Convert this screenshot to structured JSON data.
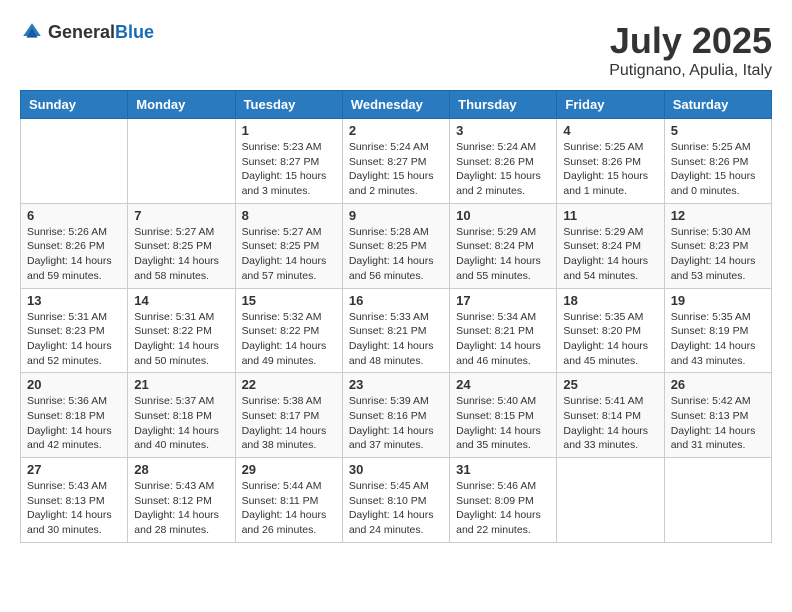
{
  "logo": {
    "text_general": "General",
    "text_blue": "Blue"
  },
  "title": {
    "month_year": "July 2025",
    "location": "Putignano, Apulia, Italy"
  },
  "headers": [
    "Sunday",
    "Monday",
    "Tuesday",
    "Wednesday",
    "Thursday",
    "Friday",
    "Saturday"
  ],
  "weeks": [
    [
      {
        "day": "",
        "sunrise": "",
        "sunset": "",
        "daylight": ""
      },
      {
        "day": "",
        "sunrise": "",
        "sunset": "",
        "daylight": ""
      },
      {
        "day": "1",
        "sunrise": "Sunrise: 5:23 AM",
        "sunset": "Sunset: 8:27 PM",
        "daylight": "Daylight: 15 hours and 3 minutes."
      },
      {
        "day": "2",
        "sunrise": "Sunrise: 5:24 AM",
        "sunset": "Sunset: 8:27 PM",
        "daylight": "Daylight: 15 hours and 2 minutes."
      },
      {
        "day": "3",
        "sunrise": "Sunrise: 5:24 AM",
        "sunset": "Sunset: 8:26 PM",
        "daylight": "Daylight: 15 hours and 2 minutes."
      },
      {
        "day": "4",
        "sunrise": "Sunrise: 5:25 AM",
        "sunset": "Sunset: 8:26 PM",
        "daylight": "Daylight: 15 hours and 1 minute."
      },
      {
        "day": "5",
        "sunrise": "Sunrise: 5:25 AM",
        "sunset": "Sunset: 8:26 PM",
        "daylight": "Daylight: 15 hours and 0 minutes."
      }
    ],
    [
      {
        "day": "6",
        "sunrise": "Sunrise: 5:26 AM",
        "sunset": "Sunset: 8:26 PM",
        "daylight": "Daylight: 14 hours and 59 minutes."
      },
      {
        "day": "7",
        "sunrise": "Sunrise: 5:27 AM",
        "sunset": "Sunset: 8:25 PM",
        "daylight": "Daylight: 14 hours and 58 minutes."
      },
      {
        "day": "8",
        "sunrise": "Sunrise: 5:27 AM",
        "sunset": "Sunset: 8:25 PM",
        "daylight": "Daylight: 14 hours and 57 minutes."
      },
      {
        "day": "9",
        "sunrise": "Sunrise: 5:28 AM",
        "sunset": "Sunset: 8:25 PM",
        "daylight": "Daylight: 14 hours and 56 minutes."
      },
      {
        "day": "10",
        "sunrise": "Sunrise: 5:29 AM",
        "sunset": "Sunset: 8:24 PM",
        "daylight": "Daylight: 14 hours and 55 minutes."
      },
      {
        "day": "11",
        "sunrise": "Sunrise: 5:29 AM",
        "sunset": "Sunset: 8:24 PM",
        "daylight": "Daylight: 14 hours and 54 minutes."
      },
      {
        "day": "12",
        "sunrise": "Sunrise: 5:30 AM",
        "sunset": "Sunset: 8:23 PM",
        "daylight": "Daylight: 14 hours and 53 minutes."
      }
    ],
    [
      {
        "day": "13",
        "sunrise": "Sunrise: 5:31 AM",
        "sunset": "Sunset: 8:23 PM",
        "daylight": "Daylight: 14 hours and 52 minutes."
      },
      {
        "day": "14",
        "sunrise": "Sunrise: 5:31 AM",
        "sunset": "Sunset: 8:22 PM",
        "daylight": "Daylight: 14 hours and 50 minutes."
      },
      {
        "day": "15",
        "sunrise": "Sunrise: 5:32 AM",
        "sunset": "Sunset: 8:22 PM",
        "daylight": "Daylight: 14 hours and 49 minutes."
      },
      {
        "day": "16",
        "sunrise": "Sunrise: 5:33 AM",
        "sunset": "Sunset: 8:21 PM",
        "daylight": "Daylight: 14 hours and 48 minutes."
      },
      {
        "day": "17",
        "sunrise": "Sunrise: 5:34 AM",
        "sunset": "Sunset: 8:21 PM",
        "daylight": "Daylight: 14 hours and 46 minutes."
      },
      {
        "day": "18",
        "sunrise": "Sunrise: 5:35 AM",
        "sunset": "Sunset: 8:20 PM",
        "daylight": "Daylight: 14 hours and 45 minutes."
      },
      {
        "day": "19",
        "sunrise": "Sunrise: 5:35 AM",
        "sunset": "Sunset: 8:19 PM",
        "daylight": "Daylight: 14 hours and 43 minutes."
      }
    ],
    [
      {
        "day": "20",
        "sunrise": "Sunrise: 5:36 AM",
        "sunset": "Sunset: 8:18 PM",
        "daylight": "Daylight: 14 hours and 42 minutes."
      },
      {
        "day": "21",
        "sunrise": "Sunrise: 5:37 AM",
        "sunset": "Sunset: 8:18 PM",
        "daylight": "Daylight: 14 hours and 40 minutes."
      },
      {
        "day": "22",
        "sunrise": "Sunrise: 5:38 AM",
        "sunset": "Sunset: 8:17 PM",
        "daylight": "Daylight: 14 hours and 38 minutes."
      },
      {
        "day": "23",
        "sunrise": "Sunrise: 5:39 AM",
        "sunset": "Sunset: 8:16 PM",
        "daylight": "Daylight: 14 hours and 37 minutes."
      },
      {
        "day": "24",
        "sunrise": "Sunrise: 5:40 AM",
        "sunset": "Sunset: 8:15 PM",
        "daylight": "Daylight: 14 hours and 35 minutes."
      },
      {
        "day": "25",
        "sunrise": "Sunrise: 5:41 AM",
        "sunset": "Sunset: 8:14 PM",
        "daylight": "Daylight: 14 hours and 33 minutes."
      },
      {
        "day": "26",
        "sunrise": "Sunrise: 5:42 AM",
        "sunset": "Sunset: 8:13 PM",
        "daylight": "Daylight: 14 hours and 31 minutes."
      }
    ],
    [
      {
        "day": "27",
        "sunrise": "Sunrise: 5:43 AM",
        "sunset": "Sunset: 8:13 PM",
        "daylight": "Daylight: 14 hours and 30 minutes."
      },
      {
        "day": "28",
        "sunrise": "Sunrise: 5:43 AM",
        "sunset": "Sunset: 8:12 PM",
        "daylight": "Daylight: 14 hours and 28 minutes."
      },
      {
        "day": "29",
        "sunrise": "Sunrise: 5:44 AM",
        "sunset": "Sunset: 8:11 PM",
        "daylight": "Daylight: 14 hours and 26 minutes."
      },
      {
        "day": "30",
        "sunrise": "Sunrise: 5:45 AM",
        "sunset": "Sunset: 8:10 PM",
        "daylight": "Daylight: 14 hours and 24 minutes."
      },
      {
        "day": "31",
        "sunrise": "Sunrise: 5:46 AM",
        "sunset": "Sunset: 8:09 PM",
        "daylight": "Daylight: 14 hours and 22 minutes."
      },
      {
        "day": "",
        "sunrise": "",
        "sunset": "",
        "daylight": ""
      },
      {
        "day": "",
        "sunrise": "",
        "sunset": "",
        "daylight": ""
      }
    ]
  ]
}
